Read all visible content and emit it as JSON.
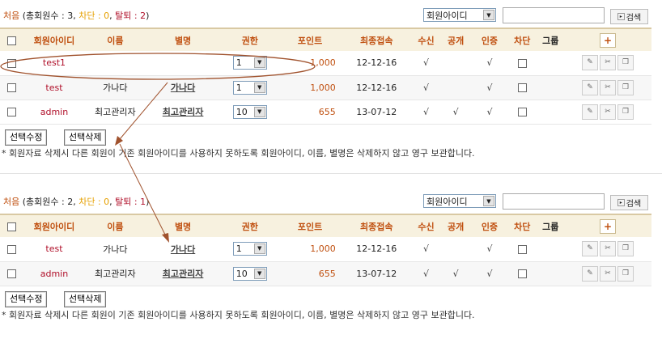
{
  "panels": [
    {
      "summary": {
        "first": "처음",
        "total": "(총회원수 : 3,",
        "ban": "차단 : 0",
        "sep": ",",
        "left": "탈퇴 : 2",
        "close": ")"
      },
      "search": {
        "select_value": "회원아이디",
        "input_value": "",
        "button_label": "검색"
      },
      "headers": [
        "회원아이디",
        "이름",
        "별명",
        "권한",
        "포인트",
        "최종접속",
        "수신",
        "공개",
        "인증",
        "차단",
        "그룹"
      ],
      "rows": [
        {
          "id": "test1",
          "name": "",
          "nick": "",
          "level": "1",
          "point": "1,000",
          "last": "12-12-16",
          "recv": "√",
          "open": "",
          "cert": "√"
        },
        {
          "id": "test",
          "name": "가나다",
          "nick": "가나다",
          "level": "1",
          "point": "1,000",
          "last": "12-12-16",
          "recv": "√",
          "open": "",
          "cert": "√"
        },
        {
          "id": "admin",
          "name": "최고관리자",
          "nick": "최고관리자",
          "level": "10",
          "point": "655",
          "last": "13-07-12",
          "recv": "√",
          "open": "√",
          "cert": "√"
        }
      ],
      "actions": {
        "edit": "선택수정",
        "delete": "선택삭제"
      },
      "notice": "* 회원자료 삭제시 다른 회원이 기존 회원아이디를 사용하지 못하도록 회원아이디, 이름, 별명은 삭제하지 않고 영구 보관합니다."
    },
    {
      "summary": {
        "first": "처음",
        "total": "(총회원수 : 2,",
        "ban": "차단 : 0",
        "sep": ",",
        "left": "탈퇴 : 1",
        "close": ")"
      },
      "search": {
        "select_value": "회원아이디",
        "input_value": "",
        "button_label": "검색"
      },
      "headers": [
        "회원아이디",
        "이름",
        "별명",
        "권한",
        "포인트",
        "최종접속",
        "수신",
        "공개",
        "인증",
        "차단",
        "그룹"
      ],
      "rows": [
        {
          "id": "test",
          "name": "가나다",
          "nick": "가나다",
          "level": "1",
          "point": "1,000",
          "last": "12-12-16",
          "recv": "√",
          "open": "",
          "cert": "√"
        },
        {
          "id": "admin",
          "name": "최고관리자",
          "nick": "최고관리자",
          "level": "10",
          "point": "655",
          "last": "13-07-12",
          "recv": "√",
          "open": "√",
          "cert": "√"
        }
      ],
      "actions": {
        "edit": "선택수정",
        "delete": "선택삭제"
      },
      "notice": "* 회원자료 삭제시 다른 회원이 기존 회원아이디를 사용하지 못하도록 회원아이디, 이름, 별명은 삭제하지 않고 영구 보관합니다."
    }
  ],
  "icons": {
    "dropdown": "chevron-down-icon",
    "add": "plus-icon",
    "edit": "pencil-icon",
    "cut": "scissors-icon",
    "copy": "copy-icon",
    "search": "search-icon"
  },
  "colors": {
    "header_bg": "#f7f1df",
    "header_text": "#c05010",
    "user_id": "#b0102a",
    "annotation": "#a0522d"
  }
}
